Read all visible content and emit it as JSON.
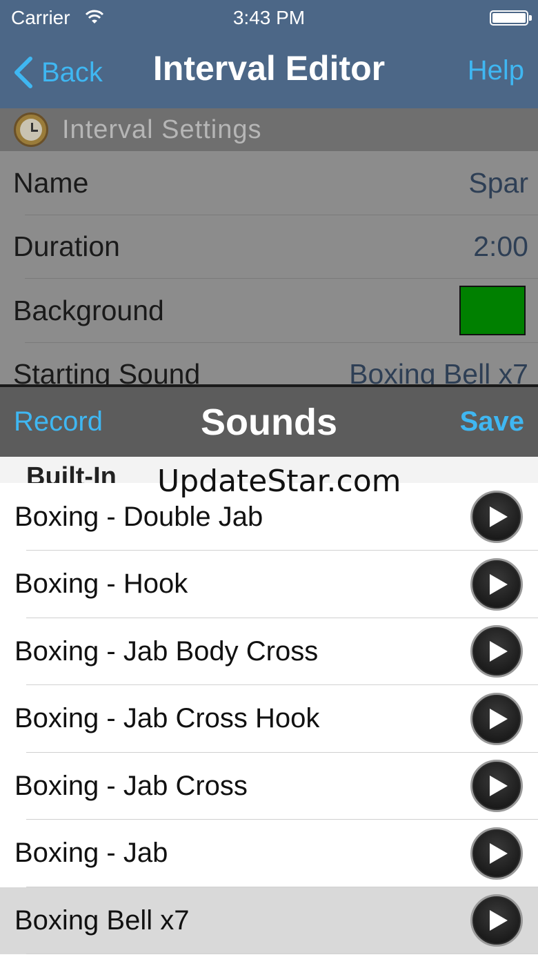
{
  "status": {
    "carrier": "Carrier",
    "time": "3:43 PM"
  },
  "nav": {
    "back_label": "Back",
    "title": "Interval Editor",
    "help_label": "Help"
  },
  "settings": {
    "section_title": "Interval Settings",
    "rows": [
      {
        "label": "Name",
        "value": "Spar"
      },
      {
        "label": "Duration",
        "value": "2:00"
      },
      {
        "label": "Background",
        "value": "",
        "color": "#008000"
      },
      {
        "label": "Starting Sound",
        "value": "Boxing Bell x7"
      }
    ]
  },
  "sounds": {
    "record_label": "Record",
    "title": "Sounds",
    "save_label": "Save",
    "section_title": "Built-In",
    "watermark": "UpdateStar.com",
    "items": [
      {
        "name": "Boxing - Double Jab"
      },
      {
        "name": "Boxing - Hook"
      },
      {
        "name": "Boxing - Jab Body Cross"
      },
      {
        "name": "Boxing - Jab Cross Hook"
      },
      {
        "name": "Boxing - Jab Cross"
      },
      {
        "name": "Boxing - Jab"
      },
      {
        "name": "Boxing Bell x7"
      }
    ],
    "selected_item": "Boxing Bell x7"
  },
  "colors": {
    "nav_bar": "#4c6787",
    "accent": "#3fb7f2",
    "background_swatch": "#008000"
  }
}
